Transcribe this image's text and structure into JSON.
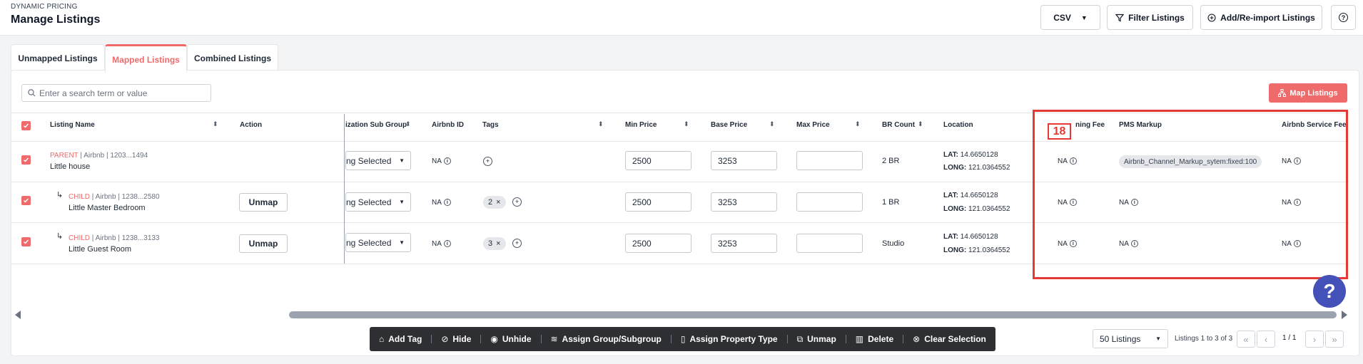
{
  "header": {
    "breadcrumb": "DYNAMIC PRICING",
    "title": "Manage Listings",
    "csv_label": "CSV",
    "filter_label": "Filter Listings",
    "add_label": "Add/Re-import Listings",
    "help_glyph": "?"
  },
  "tabs": [
    "Unmapped Listings",
    "Mapped Listings",
    "Combined Listings"
  ],
  "active_tab": "Mapped Listings",
  "search": {
    "placeholder": "Enter a search term or value"
  },
  "map_button": "Map Listings",
  "columns": {
    "listing_name": "Listing Name",
    "action": "Action",
    "sub_group": "ization Sub Group",
    "airbnb_id": "Airbnb ID",
    "tags": "Tags",
    "min_price": "Min Price",
    "base_price": "Base Price",
    "max_price": "Max Price",
    "br_count": "BR Count",
    "location": "Location",
    "cleaning_fee": "ning Fee",
    "pms_markup": "PMS Markup",
    "airbnb_service_fee": "Airbnb Service Fee"
  },
  "rows": [
    {
      "type": "PARENT",
      "meta": "Airbnb | 1203...1494",
      "name": "Little house",
      "action": "",
      "sub_group": "ng Selected",
      "airbnb_id": "NA",
      "tag_count": "",
      "tag_remove": "",
      "min_price": "2500",
      "base_price": "3253",
      "max_price": "",
      "br_count": "2 BR",
      "lat_label": "LAT:",
      "lat": "14.6650128",
      "long_label": "LONG:",
      "long": "121.0364552",
      "cleaning_fee": "NA",
      "pms_markup": "Airbnb_Channel_Markup_sytem:fixed:100",
      "service_fee": "NA"
    },
    {
      "type": "CHILD",
      "meta": "Airbnb | 1238...2580",
      "name": "Little Master Bedroom",
      "action": "Unmap",
      "sub_group": "ng Selected",
      "airbnb_id": "NA",
      "tag_count": "2",
      "tag_remove": "×",
      "min_price": "2500",
      "base_price": "3253",
      "max_price": "",
      "br_count": "1 BR",
      "lat_label": "LAT:",
      "lat": "14.6650128",
      "long_label": "LONG:",
      "long": "121.0364552",
      "cleaning_fee": "NA",
      "pms_markup": "NA",
      "service_fee": "NA"
    },
    {
      "type": "CHILD",
      "meta": "Airbnb | 1238...3133",
      "name": "Little Guest Room",
      "action": "Unmap",
      "sub_group": "ng Selected",
      "airbnb_id": "NA",
      "tag_count": "3",
      "tag_remove": "×",
      "min_price": "2500",
      "base_price": "3253",
      "max_price": "",
      "br_count": "Studio",
      "lat_label": "LAT:",
      "lat": "14.6650128",
      "long_label": "LONG:",
      "long": "121.0364552",
      "cleaning_fee": "NA",
      "pms_markup": "NA",
      "service_fee": "NA"
    }
  ],
  "annotation_label": "18",
  "bulk_actions": [
    "Add Tag",
    "Hide",
    "Unhide",
    "Assign Group/Subgroup",
    "Assign Property Type",
    "Unmap",
    "Delete",
    "Clear Selection"
  ],
  "pagination": {
    "per_page": "50 Listings",
    "range": "Listings 1 to 3 of 3",
    "page": "1 / 1"
  },
  "colors": {
    "accent": "#ef6b6b",
    "annotation": "#e53935",
    "help": "#4451b8",
    "bulk_bar": "#2d2f33"
  }
}
